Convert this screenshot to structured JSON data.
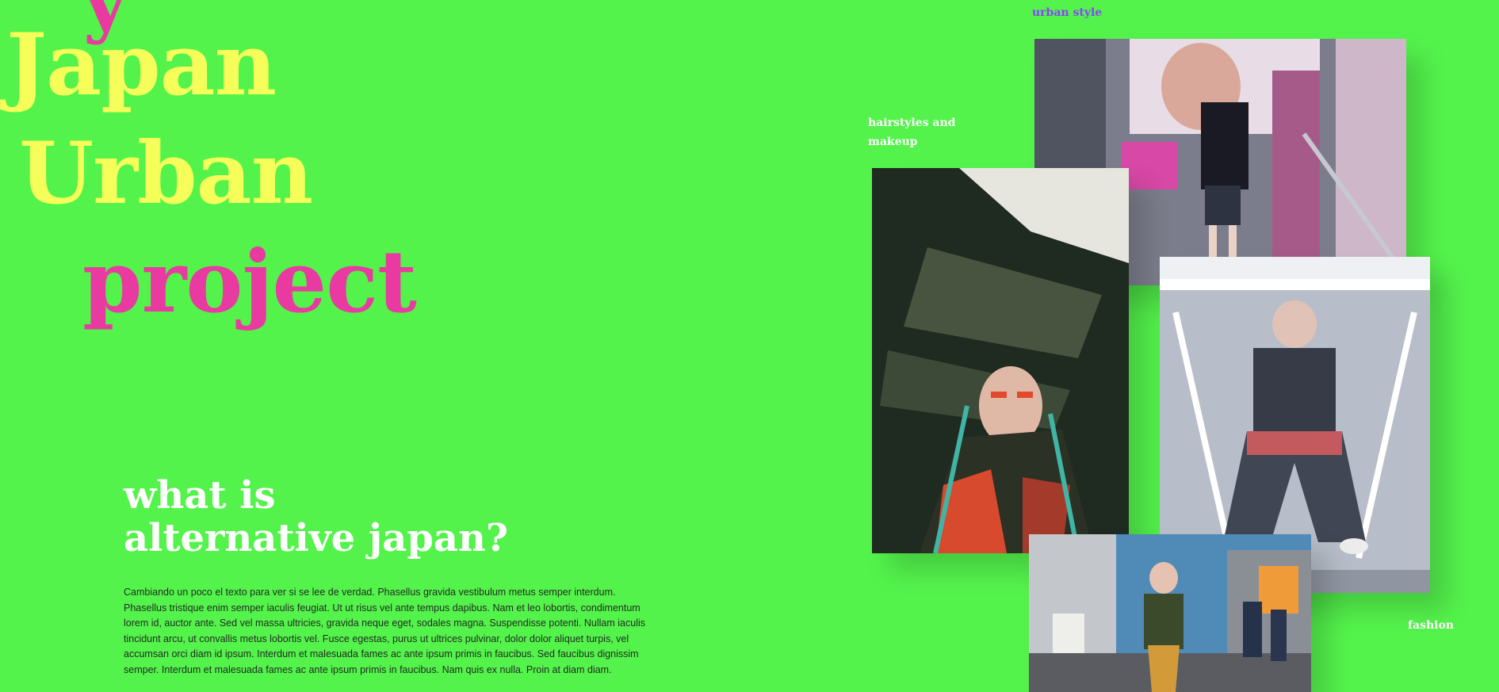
{
  "hero": {
    "line1": "Japan",
    "line2": "Urban",
    "line3": "project"
  },
  "section": {
    "title_line1": "what is",
    "title_line2": "alternative japan?",
    "body": "Cambiando un poco el texto para ver si se lee de verdad. Phasellus gravida vestibulum metus semper interdum. Phasellus tristique enim semper iaculis feugiat. Ut ut risus vel ante tempus dapibus. Nam et leo lobortis, condimentum lorem id, auctor ante. Sed vel massa ultricies, gravida neque eget, sodales magna. Suspendisse potenti. Nullam iaculis tincidunt arcu, ut convallis metus lobortis vel. Fusce egestas, purus ut ultrices pulvinar, dolor dolor aliquet turpis, vel accumsan orci diam id ipsum. Interdum et malesuada fames ac ante ipsum primis in faucibus. Sed faucibus dignissim semper. Interdum et malesuada fames ac ante ipsum primis in faucibus. Nam quis ex nulla. Proin at diam diam."
  },
  "gallery": {
    "label_urban": "urban style",
    "label_hair": "hairstyles and makeup",
    "label_fashion": "fashion"
  },
  "colors": {
    "background": "#54f34c",
    "yellow": "#f6ff5a",
    "pink": "#e83aa0",
    "purple": "#8a42ff"
  }
}
